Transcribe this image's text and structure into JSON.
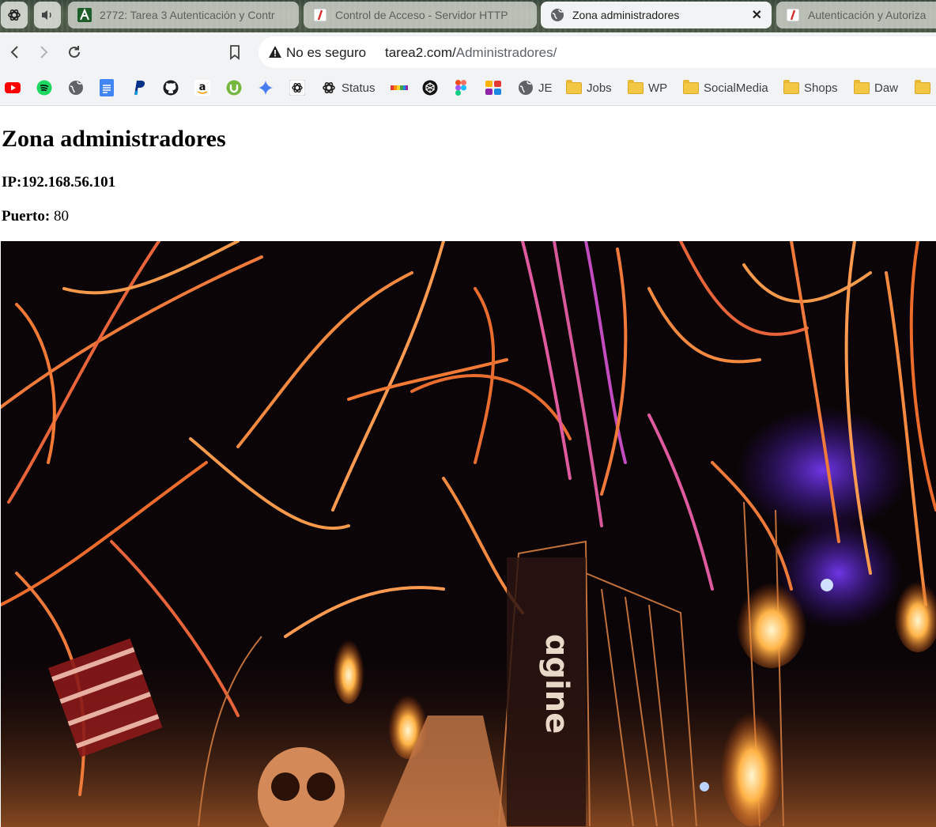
{
  "browser": {
    "tabs": [
      {
        "label": "2772: Tarea 3 Autenticación y Contr",
        "icon": "a-logo-icon",
        "active": false
      },
      {
        "label": "Control de Acceso - Servidor HTTP",
        "icon": "slash-doc-icon",
        "active": false
      },
      {
        "label": "Zona administradores",
        "icon": "globe-icon",
        "active": true
      },
      {
        "label": "Autenticación y Autoriza",
        "icon": "slash-doc-icon",
        "active": false
      }
    ],
    "close_glyph": "✕",
    "security_label": "No es seguro",
    "url_host": "tarea2.com/",
    "url_path": "Administradores/"
  },
  "bookmarks": {
    "labeled": [
      "Status",
      "JE",
      "Jobs",
      "WP",
      "SocialMedia",
      "Shops",
      "Daw"
    ]
  },
  "page": {
    "title": "Zona administradores",
    "ip_label": "IP:",
    "ip_value": "192.168.56.101",
    "port_label": "Puerto:",
    "port_value": "80"
  },
  "colors": {
    "accent_fire": "#ff7a2a",
    "streamer_pink": "#e05aa0",
    "night": "#0b0507"
  }
}
